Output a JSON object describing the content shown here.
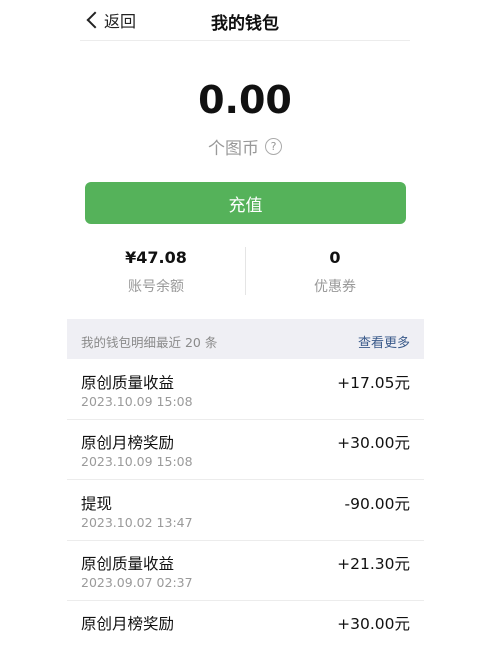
{
  "nav": {
    "back_label": "返回",
    "title": "我的钱包"
  },
  "wallet": {
    "balance": "0.00",
    "unit": "个图币",
    "help_icon": "question-circle-icon"
  },
  "recharge_label": "充值",
  "stats": {
    "account": {
      "value": "¥47.08",
      "label": "账号余额"
    },
    "coupon": {
      "value": "0",
      "label": "优惠券"
    }
  },
  "history": {
    "title": "我的钱包明细最近 20 条",
    "more_label": "查看更多",
    "items": [
      {
        "name": "原创质量收益",
        "time": "2023.10.09 15:08",
        "amount": "+17.05元"
      },
      {
        "name": "原创月榜奖励",
        "time": "2023.10.09 15:08",
        "amount": "+30.00元"
      },
      {
        "name": "提现",
        "time": "2023.10.02 13:47",
        "amount": "-90.00元"
      },
      {
        "name": "原创质量收益",
        "time": "2023.09.07 02:37",
        "amount": "+21.30元"
      },
      {
        "name": "原创月榜奖励",
        "time": "",
        "amount": "+30.00元"
      }
    ]
  },
  "colors": {
    "accent_green": "#55b25a",
    "link_blue": "#3a5a8a",
    "header_bg": "#efeff4"
  }
}
